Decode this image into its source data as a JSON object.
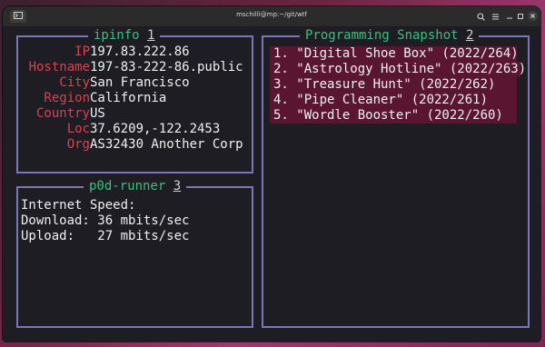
{
  "window": {
    "title": "mschilli@mp:~/git/wtf"
  },
  "ipinfo": {
    "title": "ipinfo",
    "number": "1",
    "rows": [
      {
        "key": "IP",
        "value": "197.83.222.86"
      },
      {
        "key": "Hostname",
        "value": "197-83-222-86.public"
      },
      {
        "key": "City",
        "value": "San Francisco"
      },
      {
        "key": "Region",
        "value": "California"
      },
      {
        "key": "Country",
        "value": "US"
      },
      {
        "key": "Loc",
        "value": "37.6209,-122.2453"
      },
      {
        "key": "Org",
        "value": "AS32430 Another Corp"
      }
    ]
  },
  "snapshot": {
    "title": "Programming Snapshot",
    "number": "2",
    "items": [
      "1. \"Digital Shoe Box\" (2022/264)",
      "2. \"Astrology Hotline\" (2022/263)",
      "3. \"Treasure Hunt\" (2022/262)",
      "4. \"Pipe Cleaner\" (2022/261)",
      "5. \"Wordle Booster\" (2022/260)"
    ]
  },
  "runner": {
    "title": "p0d-runner",
    "number": "3",
    "lines": [
      "Internet Speed:",
      "Download: 36 mbits/sec",
      "Upload:   27 mbits/sec"
    ]
  },
  "colors": {
    "border": "#7a76b8",
    "title": "#3fbf7f",
    "key": "#d9424f",
    "highlight": "#5a1530"
  }
}
